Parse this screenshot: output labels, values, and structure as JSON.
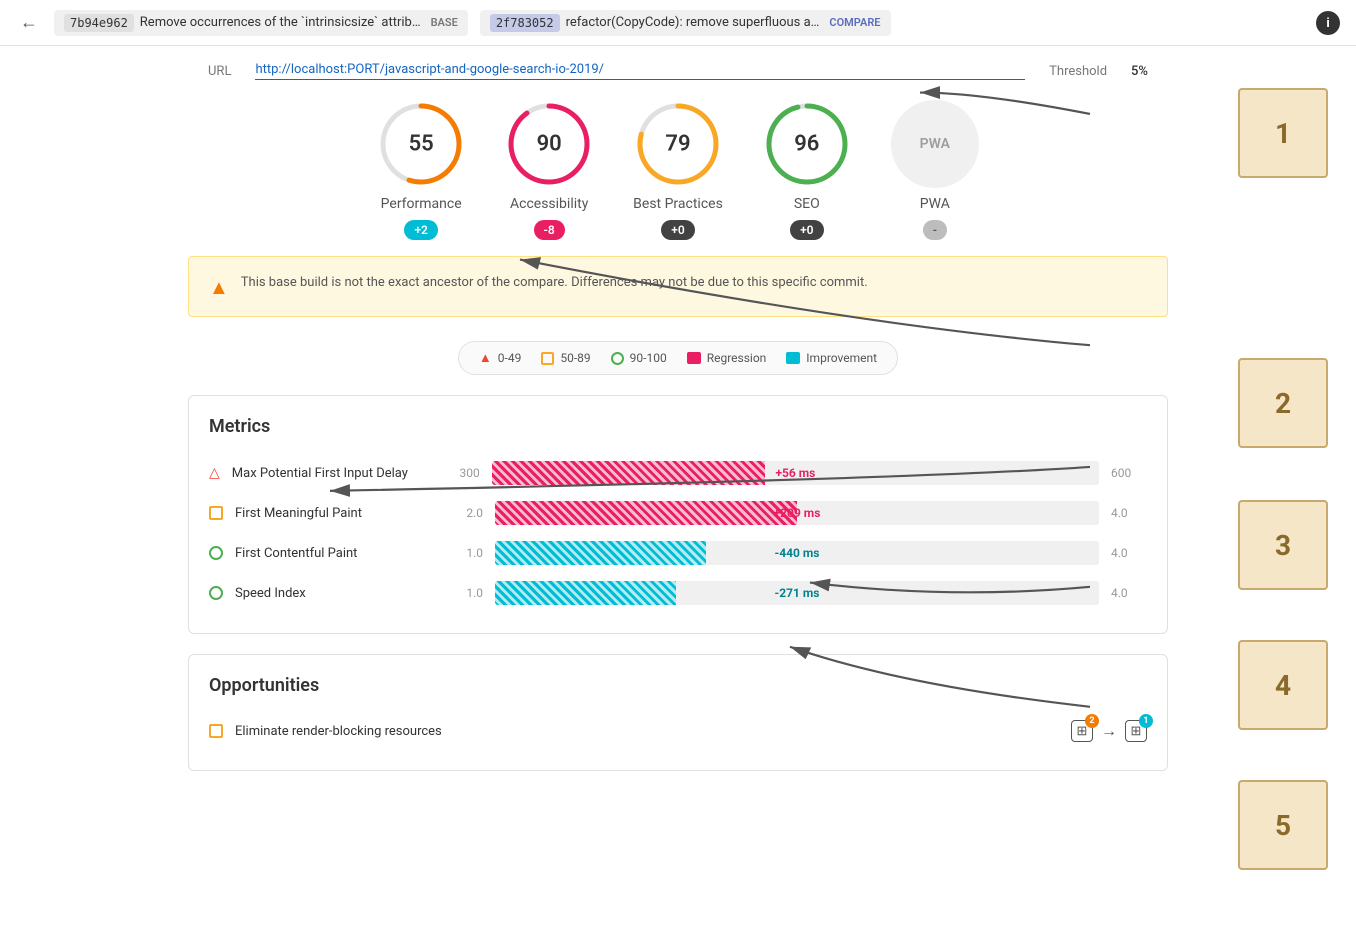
{
  "topbar": {
    "back_label": "←",
    "base_hash": "7b94e962",
    "base_desc": "Remove occurrences of the `intrinsicsize` attrib…",
    "base_label": "BASE",
    "compare_hash": "2f783052",
    "compare_desc": "refactor(CopyCode): remove superfluous a…",
    "compare_label": "COMPARE",
    "info_label": "i"
  },
  "url_bar": {
    "url_label": "URL",
    "url_value": "http://localhost:PORT/javascript-and-google-search-io-2019/",
    "threshold_label": "Threshold",
    "threshold_value": "5%"
  },
  "scores": [
    {
      "id": "performance",
      "value": "55",
      "label": "Performance",
      "badge": "+2",
      "badge_type": "positive",
      "color_track": "#e0e0e0",
      "color_fill": "#f57c00",
      "fill_pct": 55
    },
    {
      "id": "accessibility",
      "value": "90",
      "label": "Accessibility",
      "badge": "-8",
      "badge_type": "negative",
      "color_track": "#e0e0e0",
      "color_fill": "#e91e63",
      "fill_pct": 90
    },
    {
      "id": "bestpractices",
      "value": "79",
      "label": "Best Practices",
      "badge": "+0",
      "badge_type": "neutral",
      "color_track": "#e0e0e0",
      "color_fill": "#f9a825",
      "fill_pct": 79
    },
    {
      "id": "seo",
      "value": "96",
      "label": "SEO",
      "badge": "+0",
      "badge_type": "neutral",
      "color_track": "#e0e0e0",
      "color_fill": "#4caf50",
      "fill_pct": 96
    },
    {
      "id": "pwa",
      "value": "PWA",
      "label": "PWA",
      "badge": "-",
      "badge_type": "none",
      "is_pwa": true
    }
  ],
  "warning": {
    "text": "This base build is not the exact ancestor of the compare. Differences may not be due to this specific commit."
  },
  "legend": {
    "items": [
      {
        "type": "triangle",
        "label": "0-49",
        "color": "#f44336"
      },
      {
        "type": "square",
        "label": "50-89",
        "color": "#f9a825"
      },
      {
        "type": "circle",
        "label": "90-100",
        "color": "#4caf50"
      },
      {
        "type": "regression",
        "label": "Regression",
        "color": "#e91e63"
      },
      {
        "type": "improvement",
        "label": "Improvement",
        "color": "#00bcd4"
      }
    ]
  },
  "metrics": {
    "title": "Metrics",
    "rows": [
      {
        "name": "Max Potential First Input Delay",
        "icon_type": "triangle",
        "icon_color": "#f44336",
        "min": "300",
        "max": "600",
        "change": "+56 ms",
        "change_type": "regression",
        "bar_pct": 45
      },
      {
        "name": "First Meaningful Paint",
        "icon_type": "square",
        "icon_color": "#f9a825",
        "min": "2.0",
        "max": "4.0",
        "change": "+209 ms",
        "change_type": "regression",
        "bar_pct": 50
      },
      {
        "name": "First Contentful Paint",
        "icon_type": "circle",
        "icon_color": "#4caf50",
        "min": "1.0",
        "max": "4.0",
        "change": "-440 ms",
        "change_type": "improvement",
        "bar_pct": 35
      },
      {
        "name": "Speed Index",
        "icon_type": "circle",
        "icon_color": "#4caf50",
        "min": "1.0",
        "max": "4.0",
        "change": "-271 ms",
        "change_type": "improvement",
        "bar_pct": 30
      }
    ]
  },
  "opportunities": {
    "title": "Opportunities",
    "rows": [
      {
        "name": "Eliminate render-blocking resources",
        "badge_count_left": "2",
        "badge_count_right": "1"
      }
    ]
  },
  "annotations": [
    "1",
    "2",
    "3",
    "4",
    "5"
  ]
}
